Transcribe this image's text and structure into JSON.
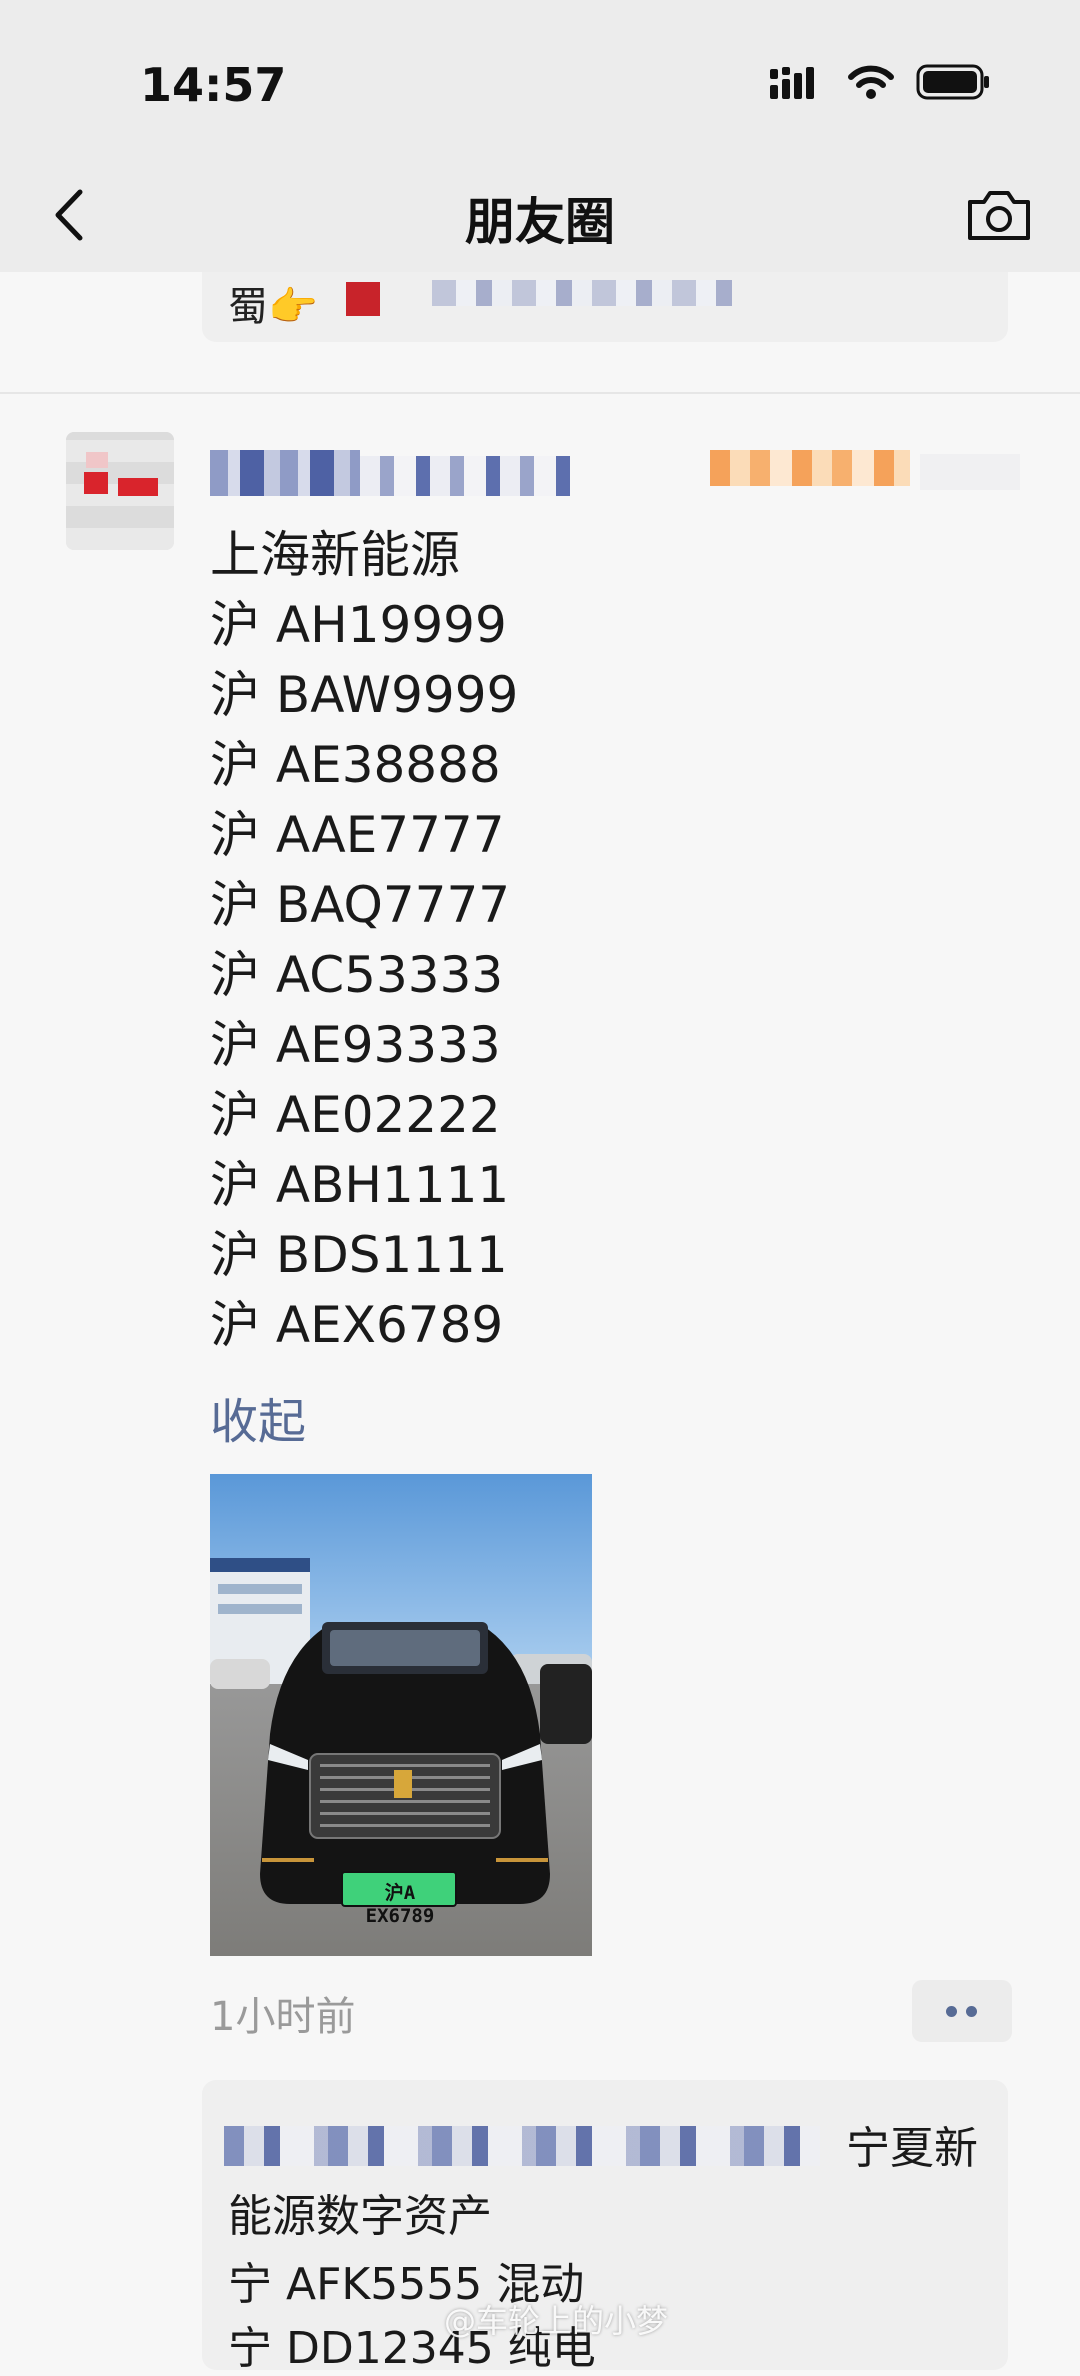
{
  "status_bar": {
    "time": "14:57"
  },
  "nav": {
    "title": "朋友圈"
  },
  "prev_comment": {
    "text": "蜀👉"
  },
  "post": {
    "lines": [
      "上海新能源",
      "沪 AH19999",
      "沪 BAW9999",
      "沪 AE38888",
      "沪 AAE7777",
      "沪 BAQ7777",
      "沪 AC53333",
      "沪 AE93333",
      "沪 AE02222",
      "沪 ABH1111",
      "沪 BDS1111",
      "沪 AEX6789"
    ],
    "collapse_label": "收起",
    "plate_text": "沪A EX6789",
    "time_ago": "1小时前"
  },
  "comment": {
    "line1_tail": "宁夏新",
    "line2": "能源数字资产",
    "line3": "宁 AFK5555 混动",
    "line4": "宁 DD12345 纯电"
  },
  "watermark": "@车轮上的小梦",
  "colors": {
    "link": "#576b95",
    "bar": "#ececec",
    "bg": "#f7f7f7"
  }
}
